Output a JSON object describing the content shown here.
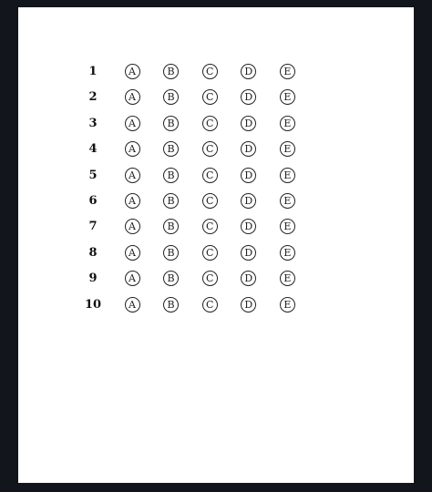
{
  "answer_sheet": {
    "choices": [
      "A",
      "B",
      "C",
      "D",
      "E"
    ],
    "questions": [
      {
        "number": "1"
      },
      {
        "number": "2"
      },
      {
        "number": "3"
      },
      {
        "number": "4"
      },
      {
        "number": "5"
      },
      {
        "number": "6"
      },
      {
        "number": "7"
      },
      {
        "number": "8"
      },
      {
        "number": "9"
      },
      {
        "number": "10"
      }
    ]
  }
}
